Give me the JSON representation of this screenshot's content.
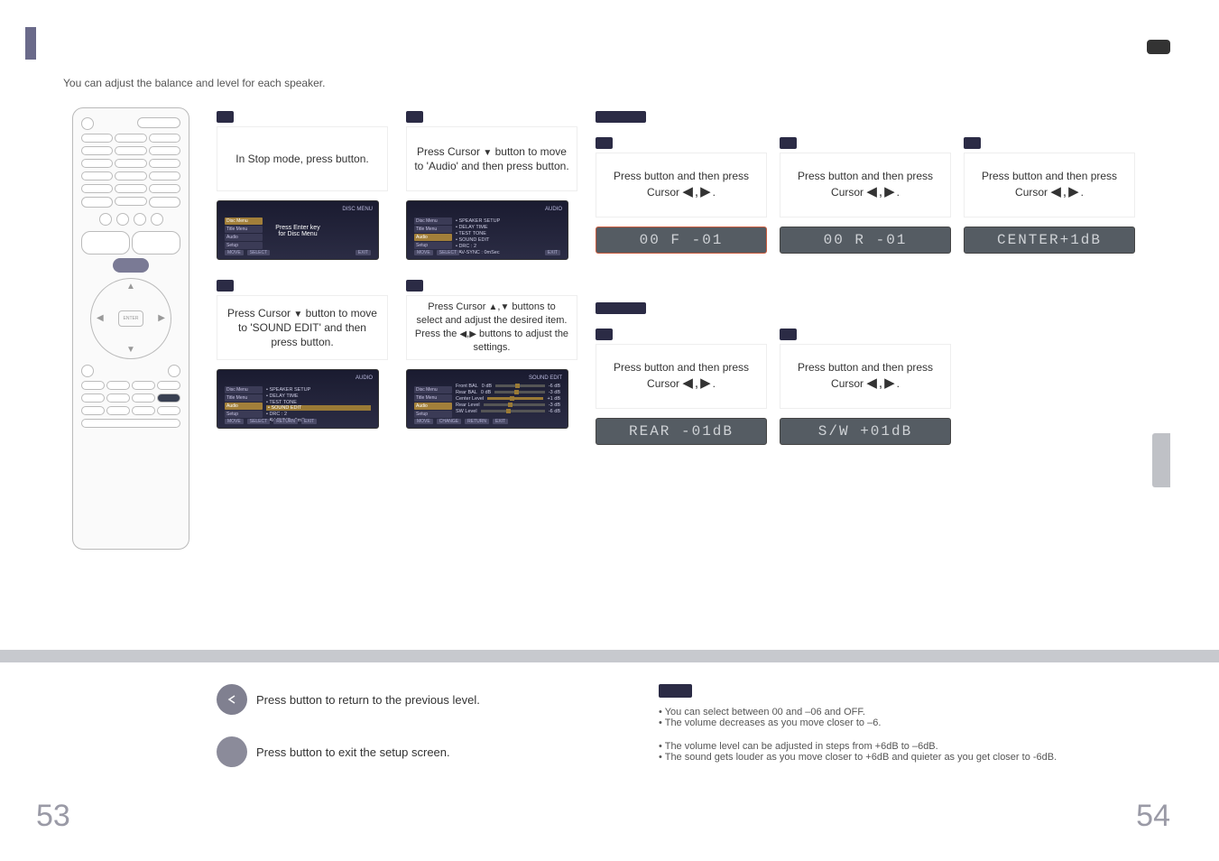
{
  "intro": "You can adjust the balance and level for each speaker.",
  "dvd": {
    "step1": "In Stop mode, press                     button.",
    "step2_a": "Press Cursor ",
    "step2_b": " button to move to 'Audio' and then press                 button.",
    "step3_a": "Press Cursor ",
    "step3_b": " button to move to 'SOUND EDIT' and then press                 button.",
    "step4_a": "Press Cursor ",
    "step4_b": " buttons to select and adjust the desired item. Press the ",
    "step4_c": " buttons to adjust the settings."
  },
  "osd": {
    "discmenu_title": "DISC MENU",
    "big1a": "Press Enter key",
    "big1b": "for Disc Menu",
    "audio_title": "AUDIO",
    "audio_items": [
      "• SPEAKER SETUP",
      "• DELAY TIME",
      "• TEST TONE",
      "• SOUND EDIT",
      "• DRC            : 2",
      "• AV-SYNC     : 0mSec"
    ],
    "soundedit_title": "SOUND EDIT",
    "se_rows": [
      {
        "l": "Front BAL",
        "v": "0 dB",
        "r": "-6 dB"
      },
      {
        "l": "Rear BAL",
        "v": "0 dB",
        "r": "-3 dB"
      },
      {
        "l": "Center Level",
        "v": "",
        "r": "+1 dB"
      },
      {
        "l": "Rear Level",
        "v": "",
        "r": "-3 dB"
      },
      {
        "l": "SW Level",
        "v": "",
        "r": "-6 dB"
      }
    ],
    "sidebar": [
      "Disc Menu",
      "Title Menu",
      "Audio",
      "Setup"
    ],
    "footer_move": "MOVE",
    "footer_select": "SELECT",
    "footer_return": "RETURN",
    "footer_exit": "EXIT",
    "footer_change": "CHANGE"
  },
  "mp3": {
    "generic_a": "Press                     button and then press Cursor ",
    "generic_b": ".",
    "displays": {
      "front": "00 F  -01",
      "rear_bal": "00 R  -01",
      "center": "CENTER+1dB",
      "rear_lvl": "REAR -01dB",
      "sw": "S/W  +01dB"
    }
  },
  "footer": {
    "return": "Press                 button to return to the previous level.",
    "exit": "Press                 button to exit the setup screen."
  },
  "notes": {
    "a1": "You can select between 00 and –06 and OFF.",
    "a2": "The volume decreases as you move closer to –6.",
    "b1": "The volume level can be adjusted in steps from +6dB to –6dB.",
    "b2": "The sound gets louder as you move closer to +6dB and quieter as you get closer to -6dB."
  },
  "page_left": "53",
  "page_right": "54",
  "remote_enter": "ENTER"
}
